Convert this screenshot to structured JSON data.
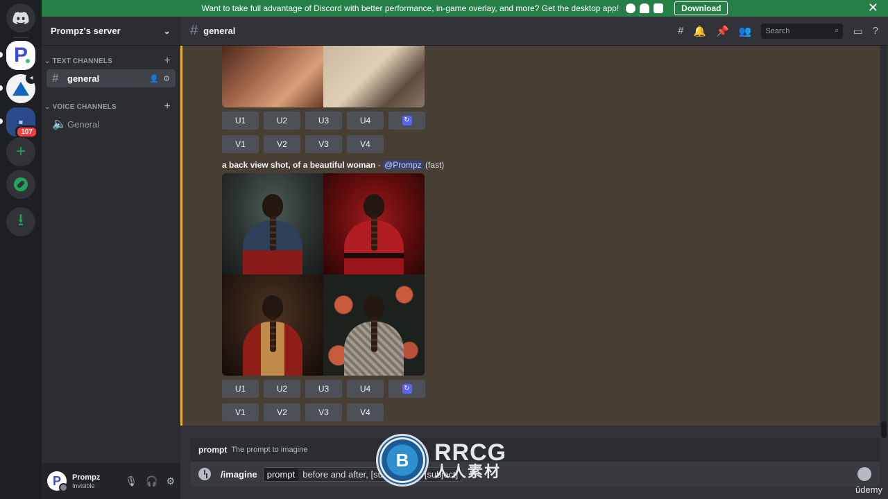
{
  "banner": {
    "message": "Want to take full advantage of Discord with better performance, in-game overlay, and more? Get the desktop app!",
    "download_label": "Download",
    "close_glyph": "✕",
    "platform_icons": [
      "apple-icon",
      "android-icon",
      "windows-icon"
    ]
  },
  "rail": {
    "servers": [
      {
        "name": "Home",
        "icon": "discord-logo-icon"
      },
      {
        "name": "Prompz's server",
        "initial": "P"
      },
      {
        "name": "boat-server",
        "icon": "sailboat-icon"
      },
      {
        "name": "group-server",
        "badge": "107"
      },
      {
        "name": "Add a Server",
        "glyph": "+"
      },
      {
        "name": "Explore",
        "icon": "compass-icon"
      },
      {
        "name": "Download Apps",
        "glyph": "⭳"
      }
    ]
  },
  "sidebar": {
    "server_name": "Prompz's server",
    "categories": [
      {
        "label": "TEXT CHANNELS",
        "channels": [
          {
            "name": "general",
            "active": true
          }
        ]
      },
      {
        "label": "VOICE CHANNELS",
        "channels": [
          {
            "name": "General",
            "active": false
          }
        ]
      }
    ]
  },
  "user": {
    "initial": "P",
    "name": "Prompz",
    "status": "Invisible"
  },
  "header": {
    "channel_name": "general",
    "search_placeholder": "Search"
  },
  "messages": {
    "upscale_buttons": [
      "U1",
      "U2",
      "U3",
      "U4"
    ],
    "variation_buttons": [
      "V1",
      "V2",
      "V3",
      "V4"
    ],
    "reroll_glyph": "↻",
    "prompt_text": "a back view shot, of a beautiful woman",
    "separator": " - ",
    "mention": "@Prompz",
    "mode": "(fast)"
  },
  "composer": {
    "tip_option": "prompt",
    "tip_description": "The prompt to imagine",
    "command": "/imagine",
    "option_name": "prompt",
    "option_value": "before and after, [subject] and [subject]"
  },
  "watermark": {
    "brand": "RRCG",
    "subtitle": "人人素材",
    "udemy": "ûdemy"
  },
  "colors": {
    "accent": "#5865f2",
    "banner": "#248046",
    "highlight": "#f0b232"
  }
}
